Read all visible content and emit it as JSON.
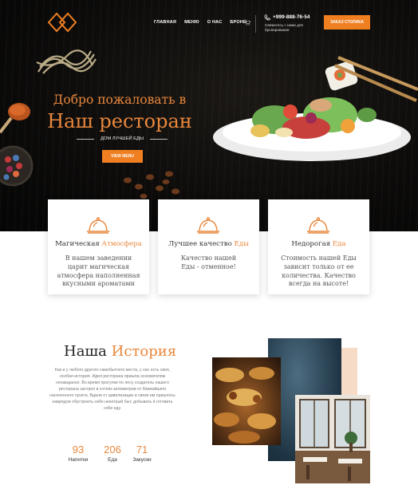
{
  "header": {
    "nav": [
      "ГЛАВНАЯ",
      "МЕНЮ",
      "О НАС",
      "БРОНЬ"
    ],
    "phone": "+999-888-76-54",
    "phone_sub": "Свяжитесь с нами для бронирования",
    "order_button": "ЗАКАЗ СТОЛИКА"
  },
  "hero": {
    "welcome": "Добро пожаловать в",
    "title": "Наш ресторан",
    "tagline": "ДОМ ЛУЧШЕЙ ЕДЫ",
    "menu_button": "VIEW MENU"
  },
  "features": [
    {
      "title_plain": "Магическая",
      "title_accent": "Атмосфера",
      "text": "В нашем заведении царит магическая атмосфера наполненная вкусными ароматами"
    },
    {
      "title_plain": "Лучшее качество",
      "title_accent": "Еды",
      "text": "Качество нашей Еды - отменное!"
    },
    {
      "title_plain": "Недорогая",
      "title_accent": "Еда",
      "text": "Стоимость нашей Еды зависит только от ее количества. Качество всегда на высоте!"
    }
  ],
  "history": {
    "title_plain": "Наша",
    "title_accent": "История",
    "text": "Как и у любого другого самобытного места, у нас есть своя, особая история. Идея ресторана пришла основателям неожиданно. Во время прогулки по лесу создатель нашего ресторана застрял в сотнях километров от ближайшего населенного пункта. Вдали от цивилизации и связи им пришлось наврядли обустроить себе нехитрый быт, добывать и готовить себе еду.",
    "stats": [
      {
        "number": "93",
        "label": "Напитки"
      },
      {
        "number": "206",
        "label": "Еда"
      },
      {
        "number": "71",
        "label": "Закуски"
      }
    ]
  },
  "icons": {
    "logo": "diamond-logo-icon",
    "cart": "cart-icon",
    "phone": "phone-icon",
    "feature": "cloche-icon"
  },
  "colors": {
    "accent": "#f07f22",
    "accent_text": "#e9873c",
    "hero_bg": "#0c0b0a"
  }
}
